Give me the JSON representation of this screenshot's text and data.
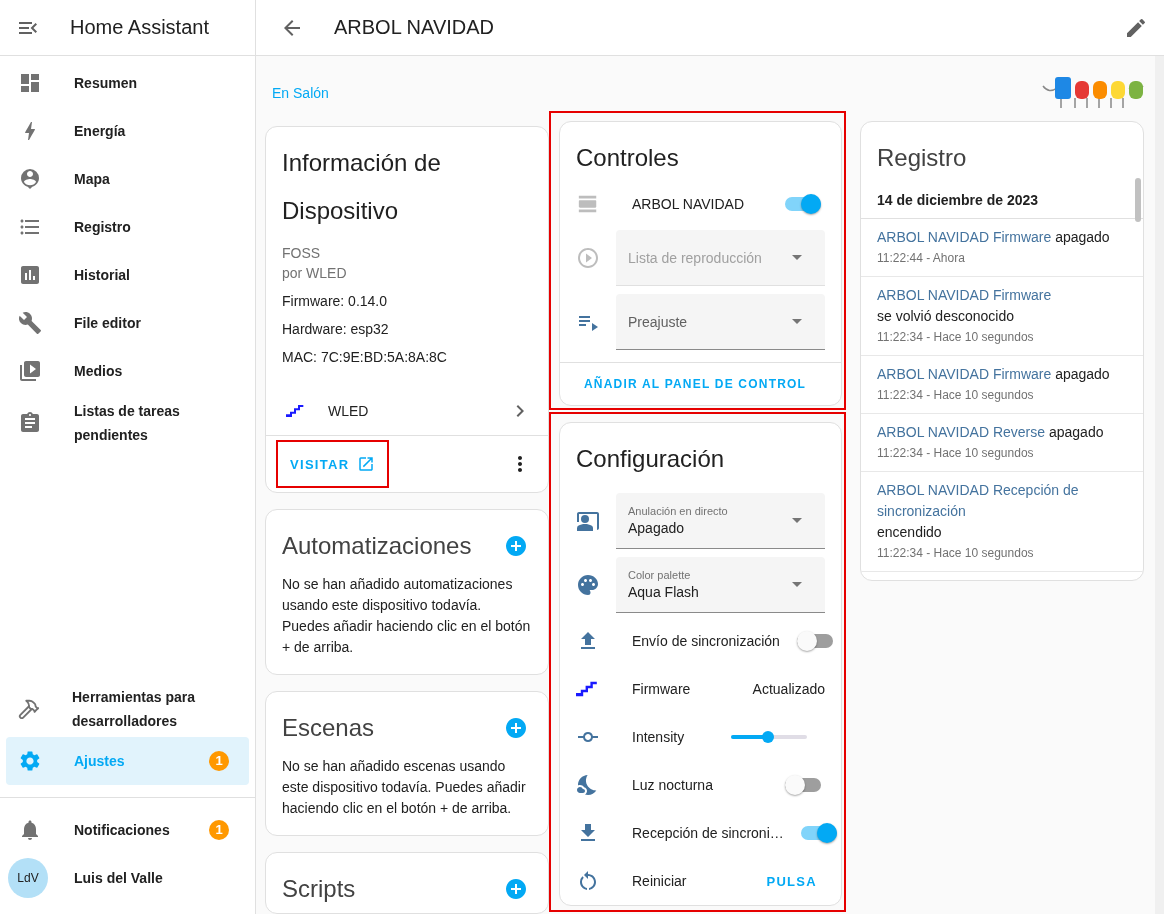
{
  "sidebar": {
    "title": "Home Assistant",
    "items": [
      {
        "label": "Resumen",
        "selected": false
      },
      {
        "label": "Energía",
        "selected": false
      },
      {
        "label": "Mapa",
        "selected": false
      },
      {
        "label": "Registro",
        "selected": false
      },
      {
        "label": "Historial",
        "selected": false
      },
      {
        "label": "File editor",
        "selected": false
      },
      {
        "label": "Medios",
        "selected": false
      },
      {
        "label": "Listas de tareas pendientes",
        "selected": false
      }
    ],
    "bottom_items": [
      {
        "label": "Herramientas para desarrolladores",
        "selected": false
      },
      {
        "label": "Ajustes",
        "selected": true,
        "badge": "1"
      }
    ],
    "notifications": {
      "label": "Notificaciones",
      "badge": "1"
    },
    "user": {
      "initials": "LdV",
      "name": "Luis del Valle"
    }
  },
  "header": {
    "title": "ARBOL NAVIDAD"
  },
  "area_link": "En Salón",
  "device_info": {
    "title": "Información de Dispositivo",
    "model": "FOSS",
    "manufacturer": "por WLED",
    "details": [
      "Firmware: 0.14.0",
      "Hardware: esp32",
      "MAC: 7C:9E:BD:5A:8A:8C"
    ],
    "integration": "WLED",
    "visit_button": {
      "label": "VISITAR",
      "highlighted": true
    }
  },
  "info_cards": [
    {
      "title": "Automatizaciones",
      "text": "No se han añadido automatizaciones usando este dispositivo todavía. Puedes añadir haciendo clic en el botón + de arriba."
    },
    {
      "title": "Escenas",
      "text": "No se han añadido escenas usando este dispositivo todavía. Puedes añadir haciendo clic en el botón + de arriba."
    },
    {
      "title": "Scripts"
    }
  ],
  "controls": {
    "title": "Controles",
    "highlighted": true,
    "rows": [
      {
        "kind": "toggle",
        "label": "ARBOL NAVIDAD",
        "on": true
      },
      {
        "kind": "select",
        "placeholder": "Lista de reproducción",
        "disabled": true
      },
      {
        "kind": "select",
        "placeholder": "Preajuste",
        "disabled": false
      }
    ],
    "action": "AÑADIR AL PANEL DE CONTROL"
  },
  "configuration": {
    "title": "Configuración",
    "highlighted": true,
    "rows": [
      {
        "kind": "select",
        "label": "Anulación en directo",
        "value": "Apagado"
      },
      {
        "kind": "select",
        "label": "Color palette",
        "value": "Aqua Flash"
      },
      {
        "kind": "toggle",
        "label": "Envío de sincronización",
        "on": false
      },
      {
        "kind": "value",
        "label": "Firmware",
        "value": "Actualizado"
      },
      {
        "kind": "slider",
        "label": "Intensity",
        "level": 0.49
      },
      {
        "kind": "toggle",
        "label": "Luz nocturna",
        "on": false
      },
      {
        "kind": "toggle",
        "label": "Recepción de sincroni…",
        "on": true
      },
      {
        "kind": "button",
        "label": "Reiniciar",
        "action": "PULSA"
      }
    ]
  },
  "logbook": {
    "title": "Registro",
    "date": "14 de diciembre de 2023",
    "entries": [
      {
        "entity": "ARBOL NAVIDAD Firmware",
        "state": "apagado",
        "time": "11:22:44 - Ahora"
      },
      {
        "entity": "ARBOL NAVIDAD Firmware",
        "state": "se volvió desconocido",
        "time": "11:22:34 - Hace 10 segundos"
      },
      {
        "entity": "ARBOL NAVIDAD Firmware",
        "state": "apagado",
        "time": "11:22:34 - Hace 10 segundos"
      },
      {
        "entity": "ARBOL NAVIDAD Reverse",
        "state": "apagado",
        "time": "11:22:34 - Hace 10 segundos"
      },
      {
        "entity": "ARBOL NAVIDAD Recepción de sincronización",
        "state": "encendido",
        "time": "11:22:34 - Hace 10 segundos"
      }
    ]
  }
}
